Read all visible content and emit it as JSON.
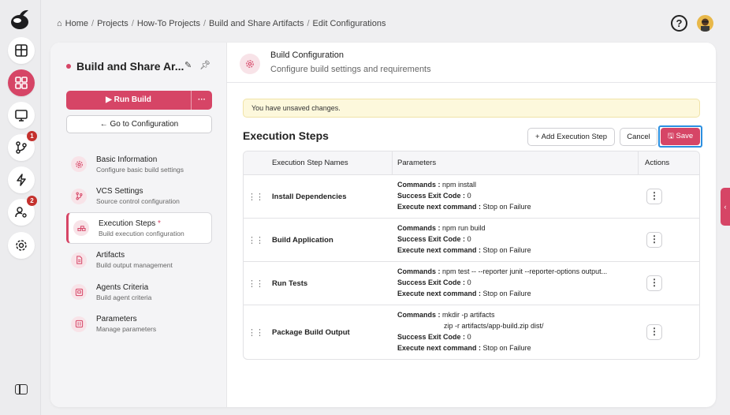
{
  "breadcrumb": [
    "Home",
    "Projects",
    "How-To Projects",
    "Build and Share Artifacts",
    "Edit Configurations"
  ],
  "rail": {
    "items": [
      {
        "icon": "logo-icon"
      },
      {
        "icon": "dashboard-icon"
      },
      {
        "icon": "projects-grid-icon",
        "active": true
      },
      {
        "icon": "monitor-icon"
      },
      {
        "icon": "git-branch-icon",
        "badge": "1"
      },
      {
        "icon": "lightning-icon"
      },
      {
        "icon": "user-settings-icon",
        "badge": "2"
      },
      {
        "icon": "gear-icon"
      }
    ]
  },
  "project": {
    "title": "Build and Share Ar...",
    "run_build": "Run Build",
    "more": "···",
    "goto_config": "← Go to Configuration"
  },
  "nav": [
    {
      "title": "Basic Information",
      "subtitle": "Configure basic build settings",
      "icon": "gear-icon"
    },
    {
      "title": "VCS Settings",
      "subtitle": "Source control configuration",
      "icon": "git-branch-icon"
    },
    {
      "title": "Execution Steps",
      "subtitle": "Build execution configuration",
      "icon": "steps-icon",
      "required": "*",
      "active": true
    },
    {
      "title": "Artifacts",
      "subtitle": "Build output management",
      "icon": "file-icon"
    },
    {
      "title": "Agents Criteria",
      "subtitle": "Build agent criteria",
      "icon": "agent-icon"
    },
    {
      "title": "Parameters",
      "subtitle": "Manage parameters",
      "icon": "parameters-icon"
    }
  ],
  "header": {
    "title": "Build Configuration",
    "subtitle": "Configure build settings and requirements"
  },
  "warning": "You have unsaved changes.",
  "section": {
    "title": "Execution Steps",
    "add_button": "Add Execution Step",
    "cancel_button": "Cancel",
    "save_button": "Save"
  },
  "table": {
    "headers": [
      "Execution Step Names",
      "Parameters",
      "Actions"
    ],
    "labels": {
      "commands": "Commands :",
      "exit_code": "Success Exit Code :",
      "next": "Execute next command :"
    },
    "rows": [
      {
        "name": "Install Dependencies",
        "commands": [
          "npm install"
        ],
        "exit_code": "0",
        "next": "Stop on Failure"
      },
      {
        "name": "Build Application",
        "commands": [
          "npm run build"
        ],
        "exit_code": "0",
        "next": "Stop on Failure"
      },
      {
        "name": "Run Tests",
        "commands": [
          "npm test -- --reporter junit --reporter-options output..."
        ],
        "exit_code": "0",
        "next": "Stop on Failure"
      },
      {
        "name": "Package Build Output",
        "commands": [
          "mkdir -p artifacts",
          "zip -r artifacts/app-build.zip dist/"
        ],
        "exit_code": "0",
        "next": "Stop on Failure"
      }
    ]
  },
  "colors": {
    "accent": "#d64566",
    "badge": "#c4312d",
    "warning_bg": "#fdf8dc",
    "focus": "#2b8fe0"
  }
}
